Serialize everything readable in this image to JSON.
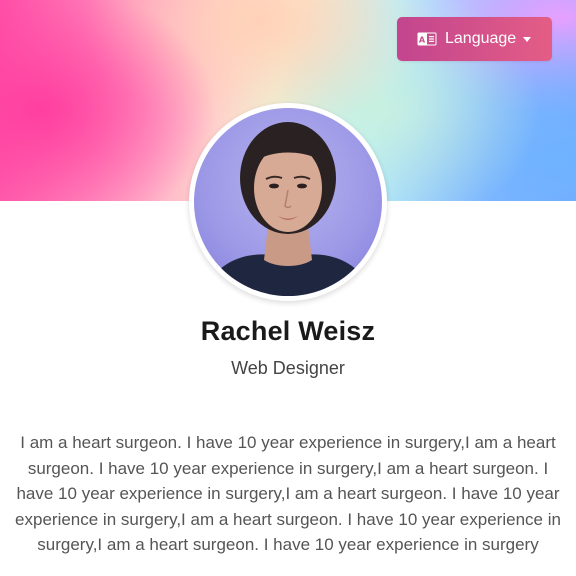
{
  "header": {
    "language_button_label": "Language",
    "language_icon": "language-icon"
  },
  "profile": {
    "name": "Rachel Weisz",
    "role": "Web Designer",
    "bio": "I am a heart surgeon. I have 10 year experience in surgery,I am a heart surgeon. I have 10 year experience in surgery,I am a heart surgeon. I have 10 year experience in surgery,I am a heart surgeon. I have 10 year experience in surgery,I am a heart surgeon. I have 10 year experience in surgery,I am a heart surgeon. I have 10 year experience in surgery"
  },
  "colors": {
    "button_gradient_start": "#c2458e",
    "button_gradient_end": "#e45d86"
  }
}
